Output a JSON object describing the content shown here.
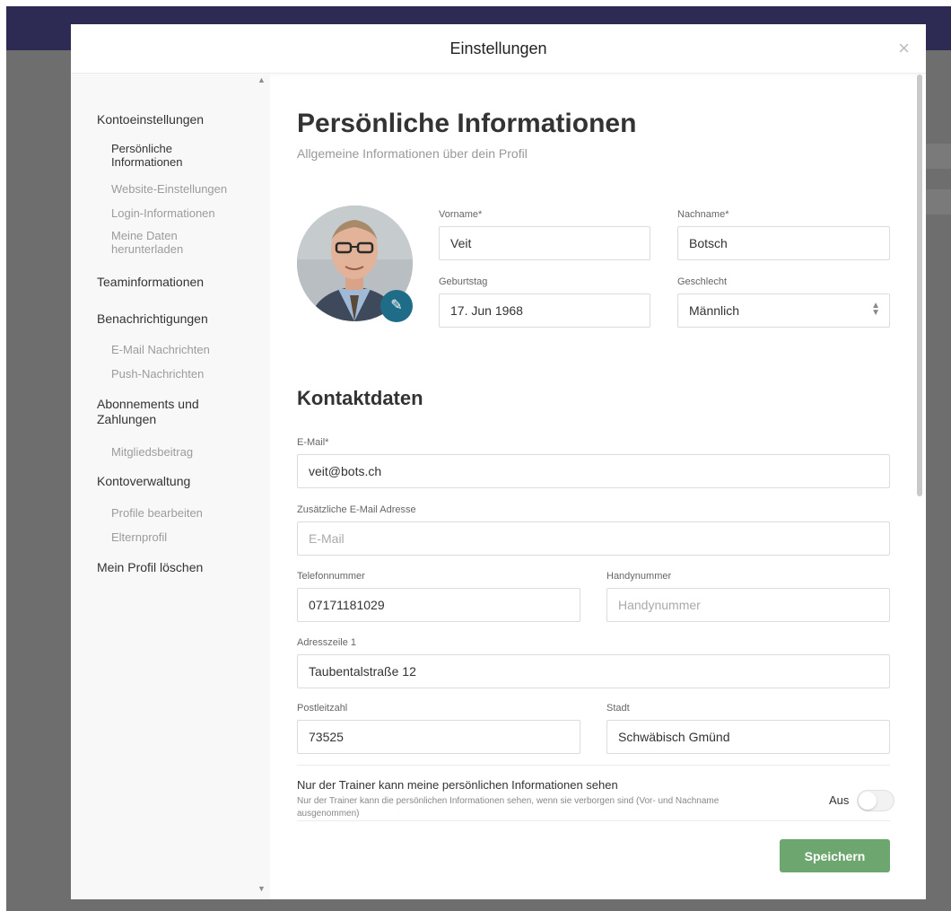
{
  "modal": {
    "title": "Einstellungen",
    "close_label": "×"
  },
  "sidebar": {
    "sections": [
      {
        "label": "Kontoeinstellungen",
        "items": [
          {
            "label": "Persönliche Informationen",
            "active": true
          },
          {
            "label": "Website-Einstellungen"
          },
          {
            "label": "Login-Informationen"
          },
          {
            "label": "Meine Daten herunterladen"
          }
        ]
      },
      {
        "label": "Teaminformationen",
        "items": []
      },
      {
        "label": "Benachrichtigungen",
        "items": [
          {
            "label": "E-Mail Nachrichten"
          },
          {
            "label": "Push-Nachrichten"
          }
        ]
      },
      {
        "label": "Abonnements und Zahlungen",
        "items": [
          {
            "label": "Mitgliedsbeitrag"
          }
        ]
      },
      {
        "label": "Kontoverwaltung",
        "items": [
          {
            "label": "Profile bearbeiten"
          },
          {
            "label": "Elternprofil"
          }
        ]
      },
      {
        "label": "Mein Profil löschen",
        "items": []
      }
    ]
  },
  "personal": {
    "title": "Persönliche Informationen",
    "subtitle": "Allgemeine Informationen über dein Profil",
    "firstname_label": "Vorname*",
    "firstname_value": "Veit",
    "lastname_label": "Nachname*",
    "lastname_value": "Botsch",
    "birthday_label": "Geburtstag",
    "birthday_value": "17. Jun 1968",
    "gender_label": "Geschlecht",
    "gender_value": "Männlich",
    "avatar_edit_icon": "pencil-icon"
  },
  "contact": {
    "title": "Kontaktdaten",
    "email_label": "E-Mail*",
    "email_value": "veit@bots.ch",
    "email2_label": "Zusätzliche E-Mail Adresse",
    "email2_placeholder": "E-Mail",
    "phone_label": "Telefonnummer",
    "phone_value": "07171181029",
    "mobile_label": "Handynummer",
    "mobile_placeholder": "Handynummer",
    "address_label": "Adresszeile 1",
    "address_value": "Taubentalstraße 12",
    "zip_label": "Postleitzahl",
    "zip_value": "73525",
    "city_label": "Stadt",
    "city_value": "Schwäbisch Gmünd"
  },
  "privacy": {
    "title": "Nur der Trainer kann meine persönlichen Informationen sehen",
    "description": "Nur der Trainer kann die persönlichen Informationen sehen, wenn sie verborgen sind (Vor- und Nachname ausgenommen)",
    "toggle_label": "Aus"
  },
  "save_label": "Speichern",
  "colors": {
    "accent": "#1f6c88",
    "save": "#6ea66f",
    "topbar": "#2d2b54"
  }
}
